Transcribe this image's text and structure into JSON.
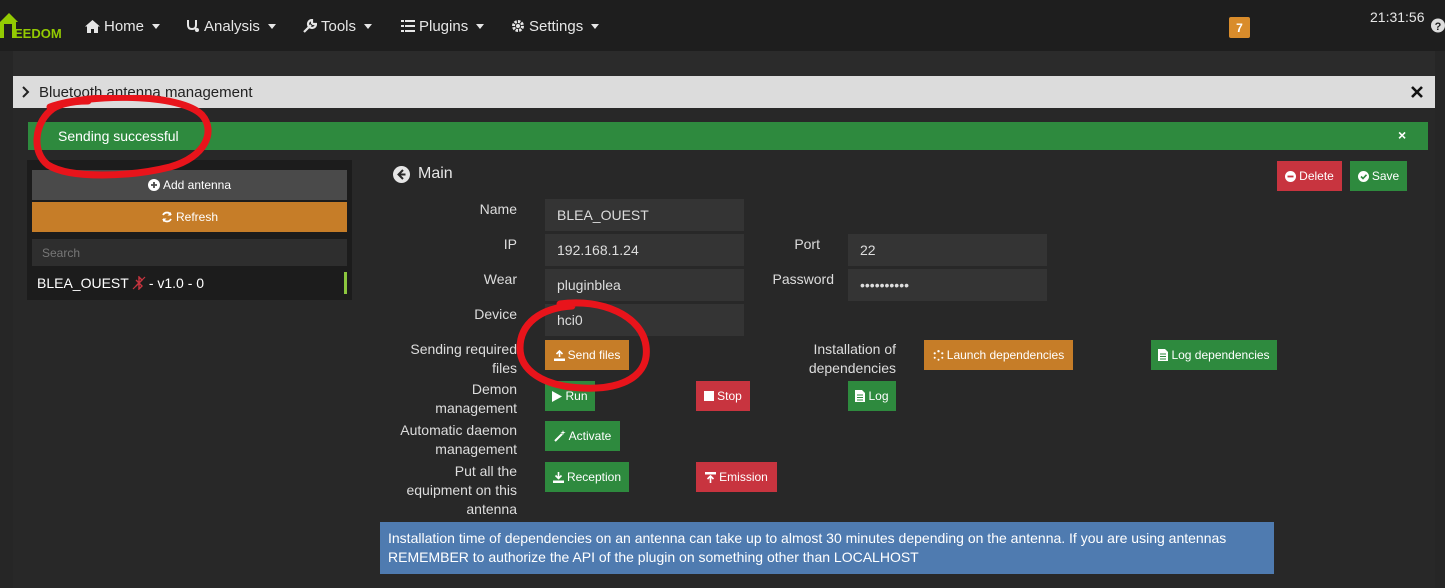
{
  "navbar": {
    "logo_text": "EEDOM",
    "items": [
      {
        "label": "Home",
        "icon": "home-icon"
      },
      {
        "label": "Analysis",
        "icon": "stethoscope-icon"
      },
      {
        "label": "Tools",
        "icon": "wrench-icon"
      },
      {
        "label": "Plugins",
        "icon": "list-icon"
      },
      {
        "label": "Settings",
        "icon": "gear-icon"
      }
    ],
    "notification_count": "7",
    "clock": "21:31:56"
  },
  "modal": {
    "title": "Bluetooth antenna management",
    "alert": "Sending successful",
    "alert_close": "×"
  },
  "sidebar": {
    "add_label": "Add antenna",
    "refresh_label": "Refresh",
    "search_placeholder": "Search",
    "antenna_name": "BLEA_OUEST",
    "antenna_suffix": "- v1.0 - 0"
  },
  "main": {
    "title": "Main",
    "delete_label": "Delete",
    "save_label": "Save",
    "fields": {
      "name_label": "Name",
      "name_value": "BLEA_OUEST",
      "ip_label": "IP",
      "ip_value": "192.168.1.24",
      "port_label": "Port",
      "port_value": "22",
      "wear_label": "Wear",
      "wear_value": "pluginblea",
      "password_label": "Password",
      "password_value": "••••••••••",
      "device_label": "Device",
      "device_value": "hci0"
    },
    "sending_label_1": "Sending required",
    "sending_label_2": "files",
    "send_files_label": "Send files",
    "install_label_1": "Installation of",
    "install_label_2": "dependencies",
    "launch_deps_label": "Launch dependencies",
    "log_deps_label": "Log dependencies",
    "demon_label_1": "Demon",
    "demon_label_2": "management",
    "run_label": "Run",
    "stop_label": "Stop",
    "log_label": "Log",
    "auto_label_1": "Automatic daemon",
    "auto_label_2": "management",
    "activate_label": "Activate",
    "put_label_1": "Put all the",
    "put_label_2": "equipment on this",
    "put_label_3": "antenna",
    "reception_label": "Reception",
    "emission_label": "Emission",
    "info_text": "Installation time of dependencies on an antenna can take up to almost 30 minutes depending on the antenna. If you are using antennas REMEMBER to authorize the API of the plugin on something other than LOCALHOST"
  },
  "colors": {
    "success": "#2e8a3e",
    "warning": "#c67d28",
    "danger": "#c8343f",
    "info": "#4f7bb0",
    "annotation": "#e8141b"
  }
}
